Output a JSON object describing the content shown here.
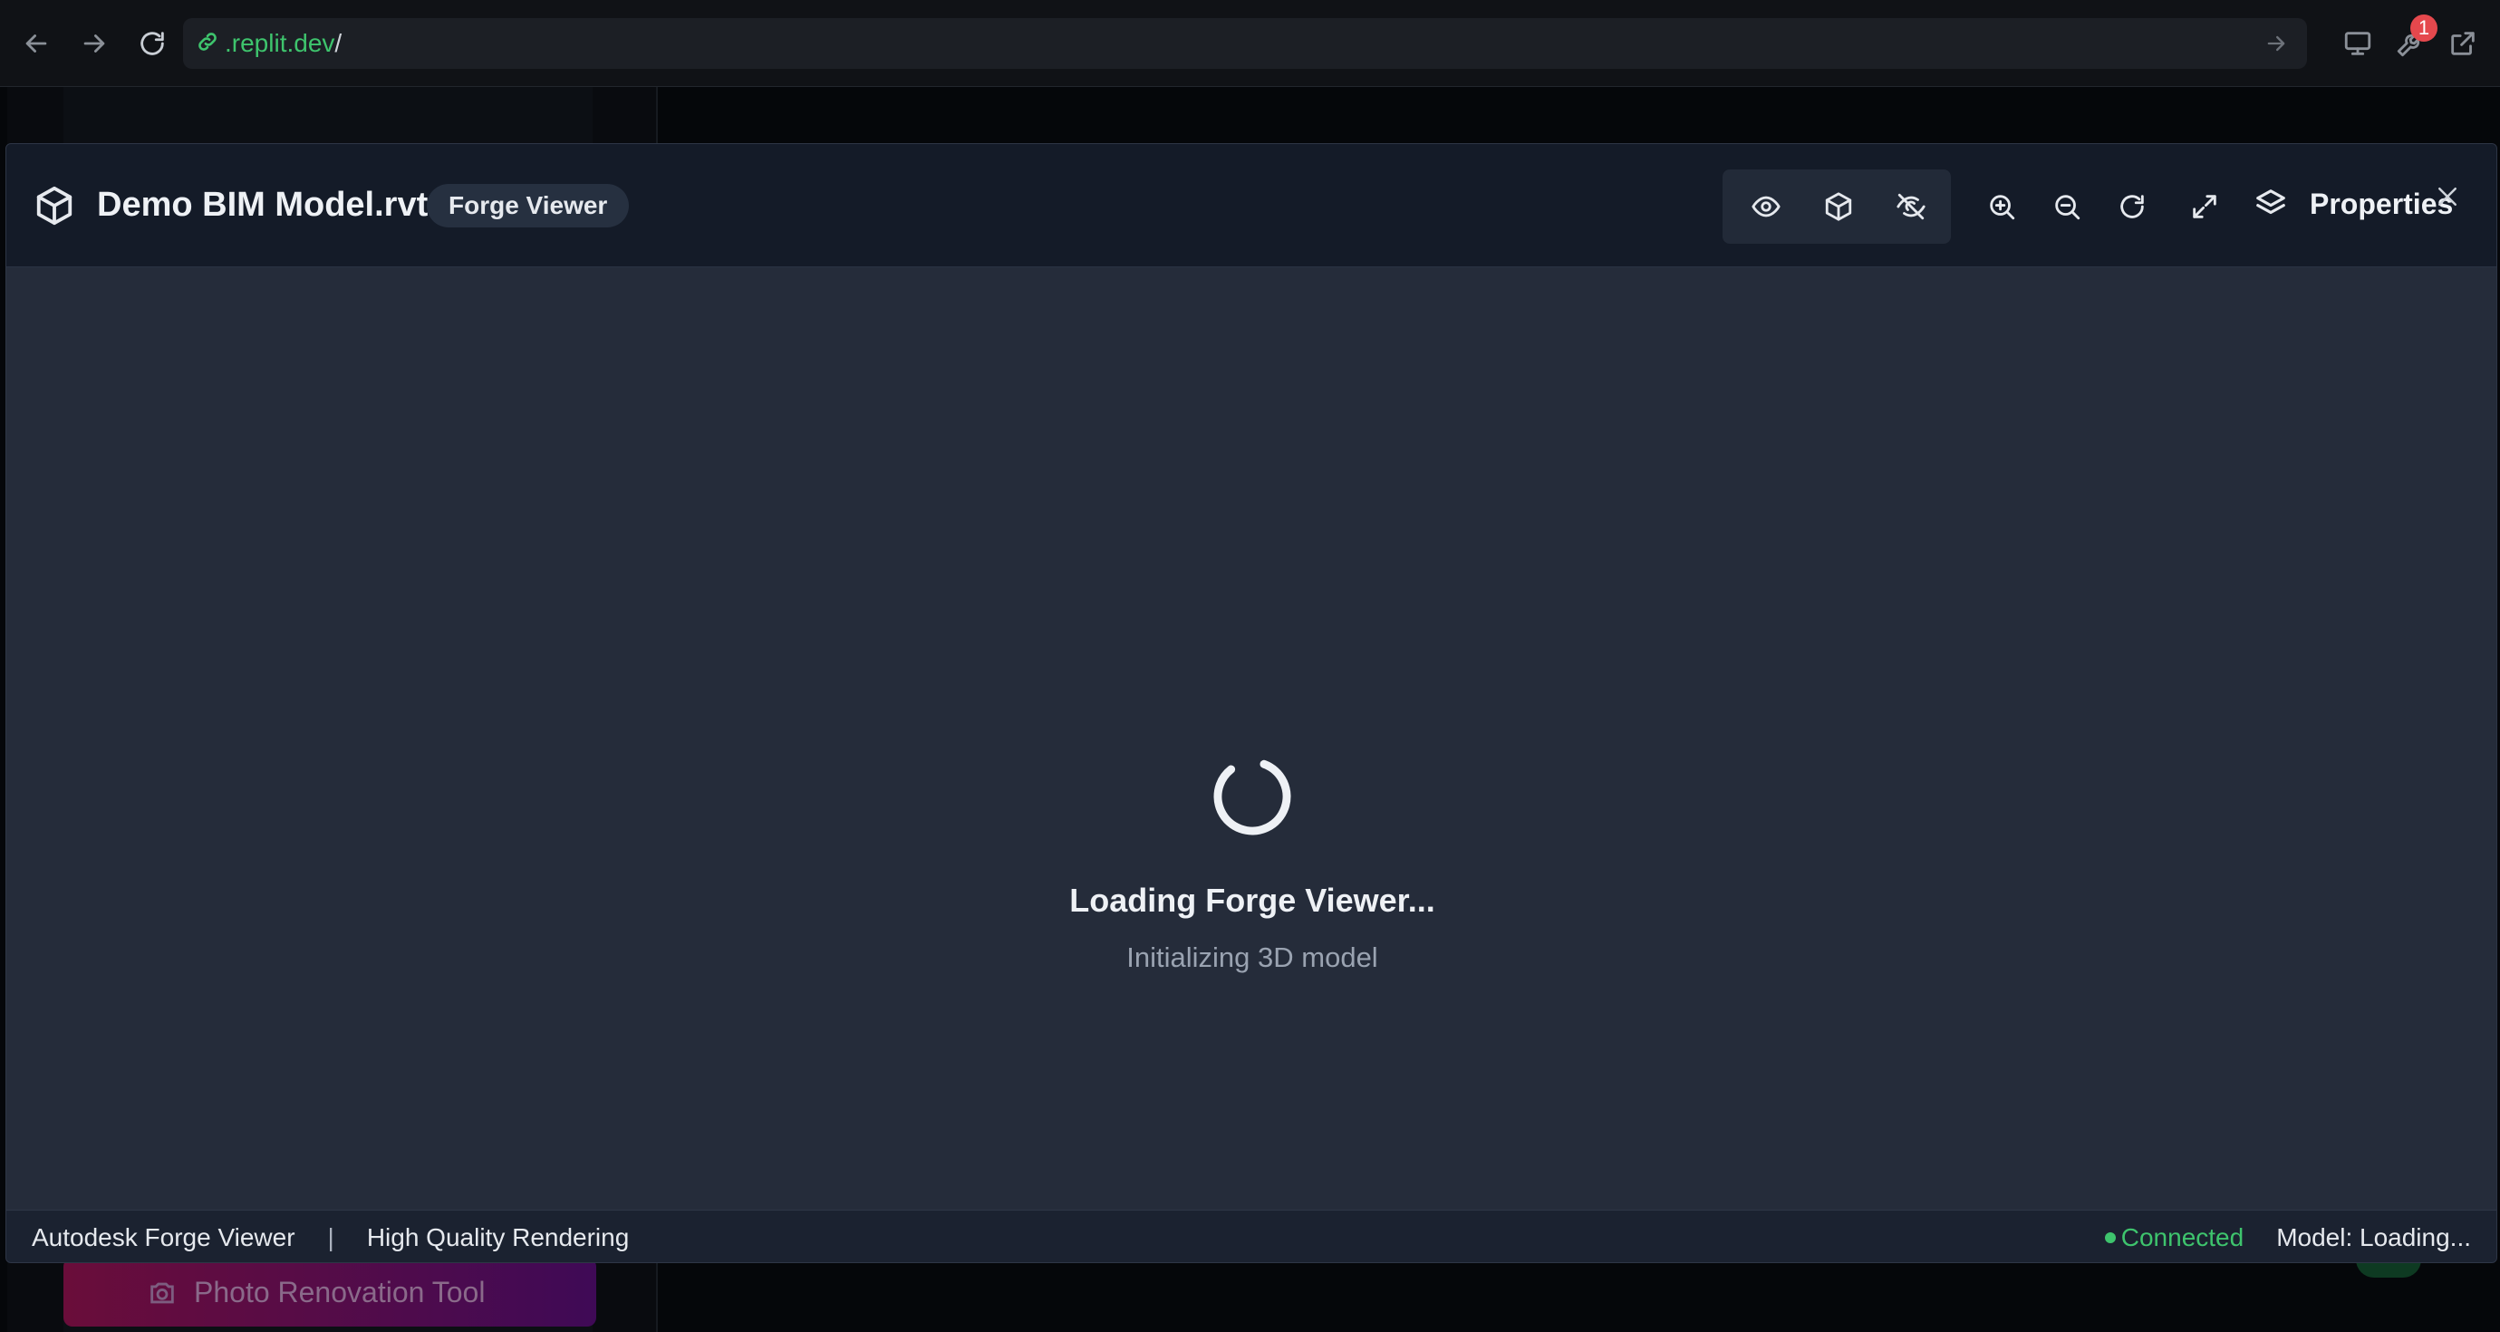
{
  "browser": {
    "url_host": ".replit.dev",
    "url_path": "/",
    "notification_count": "1"
  },
  "background": {
    "photo_tool_label": "Photo Renovation Tool"
  },
  "modal": {
    "file_name": "Demo BIM Model.rvt",
    "viewer_badge": "Forge Viewer",
    "properties_label": "Properties",
    "loading_title": "Loading Forge Viewer...",
    "loading_subtitle": "Initializing 3D model",
    "status": {
      "engine": "Autodesk Forge Viewer",
      "separator": "|",
      "rendering": "High Quality Rendering",
      "connection": "Connected",
      "model_status": "Model: Loading..."
    }
  },
  "colors": {
    "accent_green": "#3ec46d",
    "modal_bg": "#252c3a",
    "header_bg": "#141b28",
    "badge_red": "#e5484d"
  },
  "icons": [
    "back-arrow-icon",
    "forward-arrow-icon",
    "reload-icon",
    "link-icon",
    "go-arrow-icon",
    "monitor-icon",
    "wrench-icon",
    "external-link-icon",
    "cube-icon",
    "eye-icon",
    "eye-off-icon",
    "zoom-in-icon",
    "zoom-out-icon",
    "rotate-icon",
    "expand-icon",
    "layers-icon",
    "close-icon",
    "camera-icon",
    "spinner-icon"
  ]
}
